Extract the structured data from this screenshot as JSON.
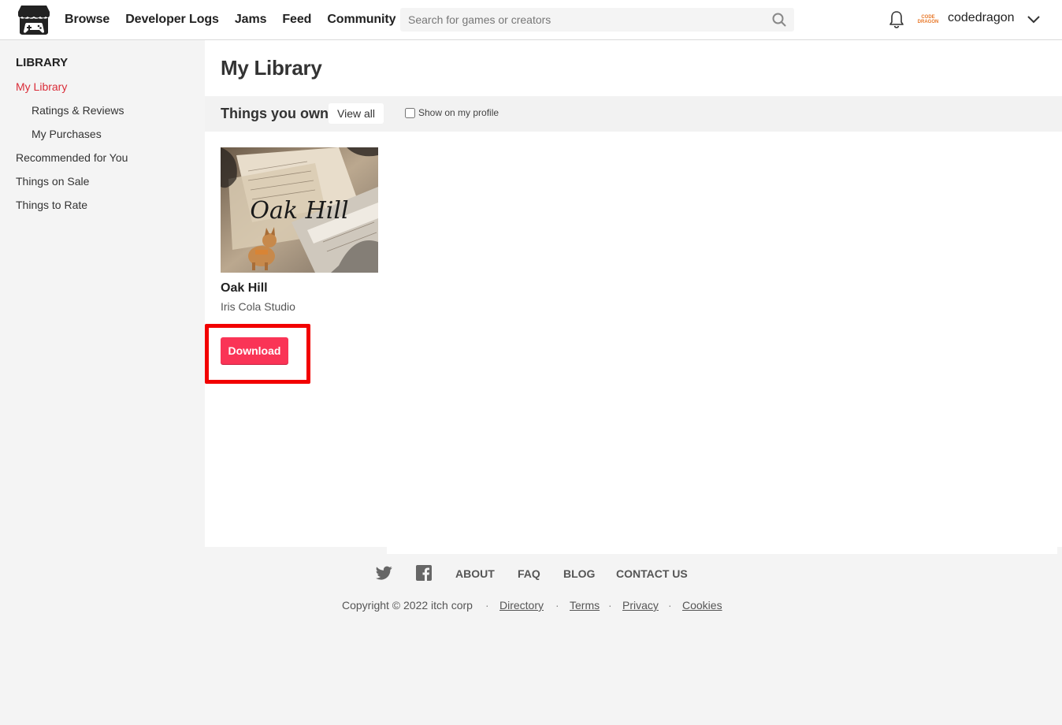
{
  "header": {
    "nav": [
      "Browse",
      "Developer Logs",
      "Jams",
      "Feed",
      "Community"
    ],
    "search_placeholder": "Search for games or creators",
    "avatar_text": "CODE DRAGON",
    "username": "codedragon"
  },
  "sidebar": {
    "title": "LIBRARY",
    "items": [
      {
        "label": "My Library"
      },
      {
        "label": "Ratings & Reviews"
      },
      {
        "label": "My Purchases"
      },
      {
        "label": "Recommended for You"
      },
      {
        "label": "Things on Sale"
      },
      {
        "label": "Things to Rate"
      }
    ]
  },
  "main": {
    "title": "My Library",
    "section_title": "Things you own",
    "view_all": "View all",
    "show_on_profile": "Show on my profile",
    "game": {
      "cover_text": "Oak Hill",
      "title": "Oak Hill",
      "author": "Iris Cola Studio",
      "download_label": "Download"
    }
  },
  "footer": {
    "links": [
      "ABOUT",
      "FAQ",
      "BLOG",
      "CONTACT US"
    ],
    "copyright": "Copyright © 2022 itch corp",
    "legal": [
      "Directory",
      "Terms",
      "Privacy",
      "Cookies"
    ]
  },
  "colors": {
    "accent": "#da2c38",
    "download": "#fa3456",
    "highlight": "#f20000"
  }
}
